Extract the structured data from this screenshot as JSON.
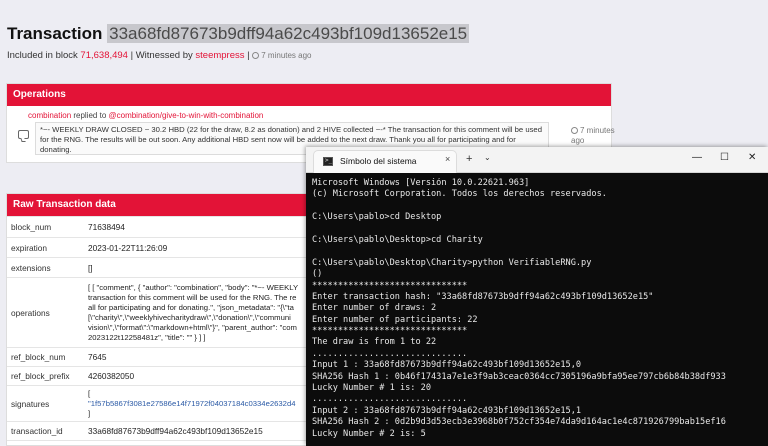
{
  "tx": {
    "label": "Transaction ",
    "hash": "33a68fd87673b9dff94a62c493bf109d13652e15",
    "included_prefix": "Included in block ",
    "block": "71,638,494",
    "witnessed_prefix": " | Witnessed by ",
    "witness": "steempress",
    "sep": " | ",
    "ago": "7 minutes ago"
  },
  "operations": {
    "title": "Operations",
    "author": "combination",
    "replied_text": " replied to ",
    "parent": "@combination/give-to-win-with-combination",
    "body": "*~- WEEKLY DRAW CLOSED ~ 30.2 HBD (22 for the draw, 8.2 as donation) and 2 HIVE collected ~-* The transaction for this comment will be used for the RNG. The results will be out soon. Any additional HBD sent now will be added to the next draw. Thank you all for participating and for donating.",
    "time": "7 minutes ago"
  },
  "raw": {
    "title": "Raw Transaction data",
    "rows": [
      {
        "key": "block_num",
        "value": "71638494"
      },
      {
        "key": "expiration",
        "value": "2023-01-22T11:26:09"
      },
      {
        "key": "extensions",
        "value": "[]"
      },
      {
        "key": "operations",
        "lines": [
          "[ [ \"comment\", { \"author\": \"combination\", \"body\": \"*~- WEEKLY",
          "transaction for this comment will be used for the RNG. The re",
          "all for participating and for donating.\", \"json_metadata\": \"{\\\"ta",
          "[\\\"charity\\\",\\\"weeklyhivecharitydraw\\\",\\\"donation\\\",\\\"communi",
          "vision\\\",\\\"format\\\":\\\"markdown+html\\\"}\", \"parent_author\": \"com",
          "2023122t12258481z\", \"title\": \"\" } ] ]"
        ]
      },
      {
        "key": "ref_block_num",
        "value": "7645"
      },
      {
        "key": "ref_block_prefix",
        "value": "4260382050"
      },
      {
        "key": "signatures",
        "lines": [
          "[",
          "\"1f57b5867f3081e27586e14f71972f04037184c0334e2632d4",
          "]"
        ]
      },
      {
        "key": "transaction_id",
        "value": "33a68fd87673b9dff94a62c493bf109d13652e15"
      },
      {
        "key": "transaction_num",
        "value": "30"
      }
    ]
  },
  "terminal": {
    "tab_title": "Símbolo del sistema",
    "tab_close": "×",
    "new_tab": "+",
    "dropdown": "⌄",
    "minimize": "—",
    "maximize": "☐",
    "close": "✕",
    "lines": [
      "Microsoft Windows [Versión 10.0.22621.963]",
      "(c) Microsoft Corporation. Todos los derechos reservados.",
      "",
      "C:\\Users\\pablo>cd Desktop",
      "",
      "C:\\Users\\pablo\\Desktop>cd Charity",
      "",
      "C:\\Users\\pablo\\Desktop\\Charity>python VerifiableRNG.py",
      "()",
      "******************************",
      "Enter transaction hash: \"33a68fd87673b9dff94a62c493bf109d13652e15\"",
      "Enter number of draws: 2",
      "Enter number of participants: 22",
      "******************************",
      "The draw is from 1 to 22",
      "..............................",
      "Input 1 : 33a68fd87673b9dff94a62c493bf109d13652e15,0",
      "SHA256 Hash 1 : 0b46f17431a7e1e3f9ab3ceac0364cc7305196a9bfa95ee797cb6b84b38df933",
      "Lucky Number # 1 is: 20",
      "..............................",
      "Input 2 : 33a68fd87673b9dff94a62c493bf109d13652e15,1",
      "SHA256 Hash 2 : 0d2b9d3d53ecb3e3968b0f752cf354e74da9d164ac1e4c871926799bab15ef16",
      "Lucky Number # 2 is: 5"
    ]
  }
}
